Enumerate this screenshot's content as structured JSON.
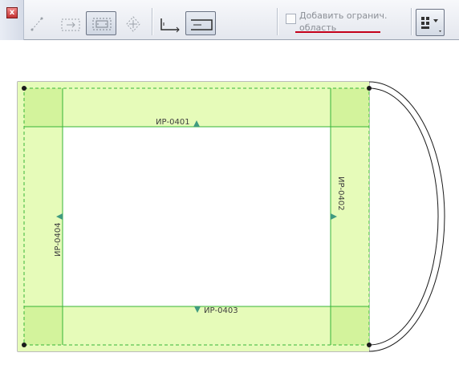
{
  "toolbar": {
    "close_glyph": "x",
    "buttons": [
      {
        "name": "no-offset-icon",
        "active": false
      },
      {
        "name": "offset-inside-icon",
        "active": false
      },
      {
        "name": "offset-both-icon",
        "active": false
      },
      {
        "name": "offset-center-icon",
        "active": false
      },
      {
        "name": "corner-left-icon",
        "active": false
      },
      {
        "name": "corner-right-icon",
        "active": true
      }
    ],
    "add_boundary_checked": false,
    "add_boundary_label": "Добавить огранич. область",
    "menu_icon": "options-menu-icon"
  },
  "drawing": {
    "labels": {
      "top": "ИР-0401",
      "right": "ИР-0402",
      "bottom": "ИР-0403",
      "left": "ИР-0404"
    },
    "colors": {
      "fill": "#e6fbb9",
      "corner_fill": "#d3f39c",
      "line": "#36b636",
      "marker": "#3f9a80"
    }
  }
}
